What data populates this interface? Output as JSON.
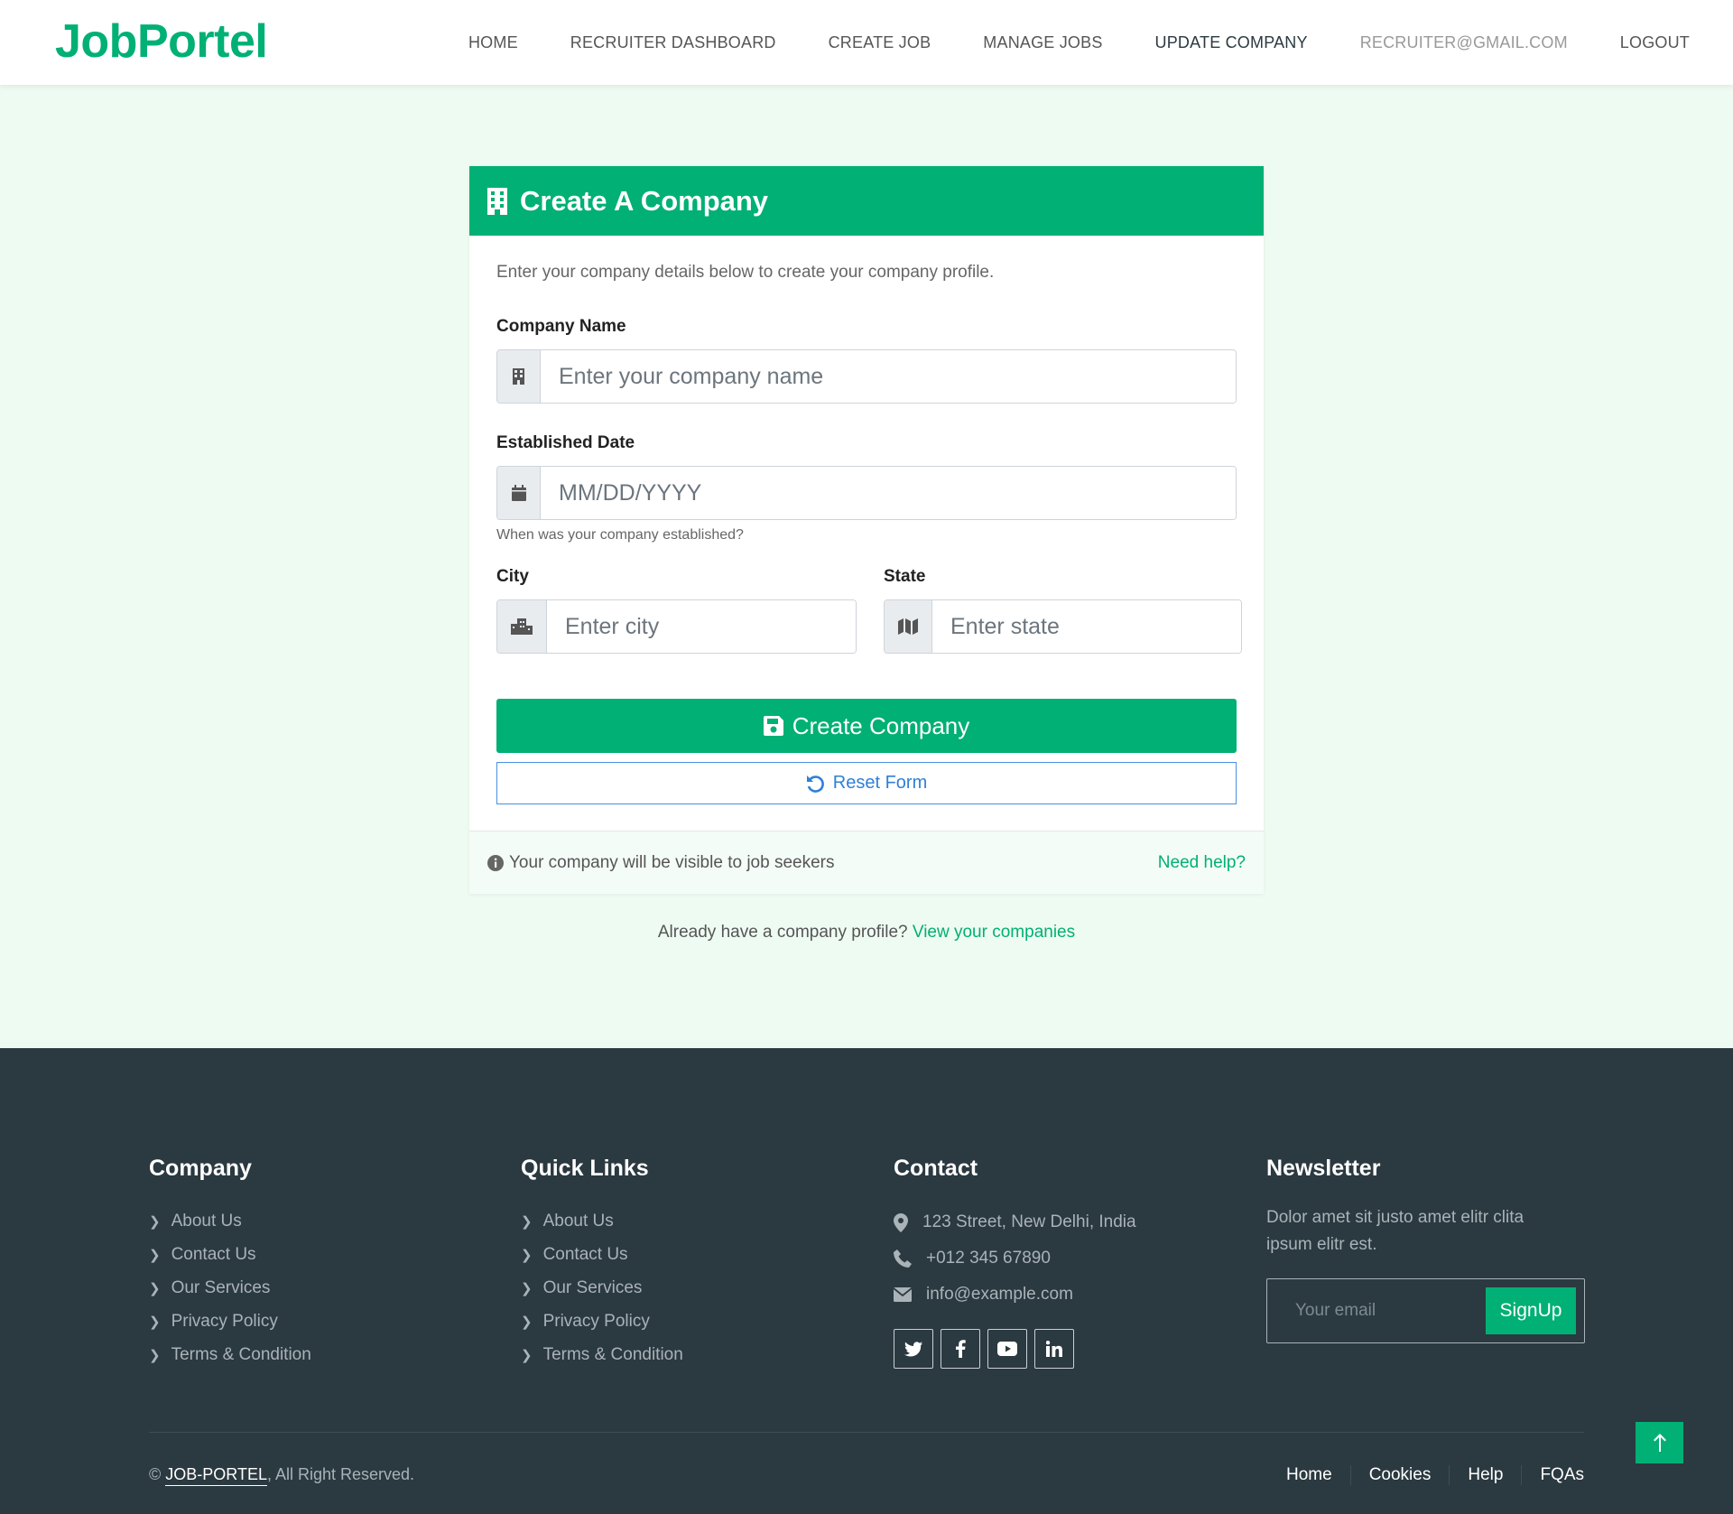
{
  "brand": "JobPortel",
  "nav": {
    "home": "HOME",
    "dashboard": "RECRUITER DASHBOARD",
    "create_job": "CREATE JOB",
    "manage_jobs": "MANAGE JOBS",
    "update_company": "UPDATE COMPANY",
    "email": "RECRUITER@GMAIL.COM",
    "logout": "LOGOUT"
  },
  "form": {
    "title": "Create A Company",
    "intro": "Enter your company details below to create your company profile.",
    "company_name_label": "Company Name",
    "company_name_placeholder": "Enter your company name",
    "date_label": "Established Date",
    "date_placeholder": "MM/DD/YYYY",
    "date_hint": "When was your company established?",
    "city_label": "City",
    "city_placeholder": "Enter city",
    "state_label": "State",
    "state_placeholder": "Enter state",
    "submit": "Create Company",
    "reset": "Reset Form",
    "visibility_note": "Your company will be visible to job seekers",
    "help_link": "Need help?"
  },
  "already": {
    "text": "Already have a company profile?",
    "link": "View your companies"
  },
  "footer": {
    "company_heading": "Company",
    "company_links": [
      "About Us",
      "Contact Us",
      "Our Services",
      "Privacy Policy",
      "Terms & Condition"
    ],
    "quick_heading": "Quick Links",
    "quick_links": [
      "About Us",
      "Contact Us",
      "Our Services",
      "Privacy Policy",
      "Terms & Condition"
    ],
    "contact_heading": "Contact",
    "address": "123 Street, New Delhi, India",
    "phone": "+012 345 67890",
    "email": "info@example.com",
    "news_heading": "Newsletter",
    "news_text": "Dolor amet sit justo amet elitr clita ipsum elitr est.",
    "news_placeholder": "Your email",
    "news_button": "SignUp",
    "copyright_symbol": "©",
    "copyright_brand": "JOB-PORTEL",
    "copyright_rest": ", All Right Reserved.",
    "bottom_menu": [
      "Home",
      "Cookies",
      "Help",
      "FQAs"
    ]
  },
  "colors": {
    "accent": "#00b074",
    "footer_bg": "#2b3940",
    "page_bg": "#eefbf2"
  }
}
